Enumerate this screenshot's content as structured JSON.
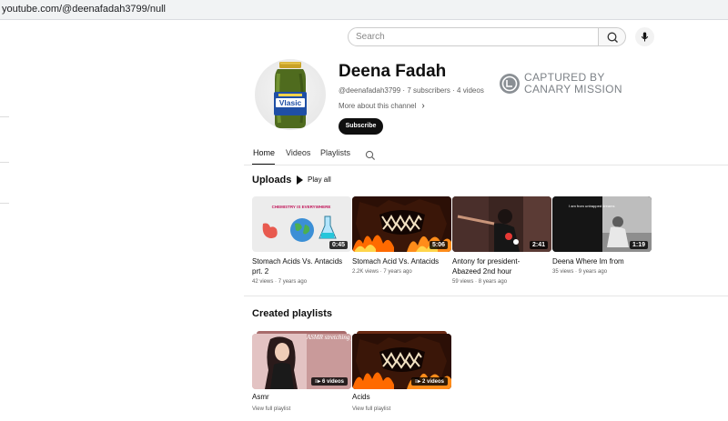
{
  "browser": {
    "url": "youtube.com/@deenafadah3799/null"
  },
  "search": {
    "placeholder": "Search"
  },
  "channel": {
    "name": "Deena Fadah",
    "handle": "@deenafadah3799",
    "subscribers": "7 subscribers",
    "videos_count": "4 videos",
    "more_about": "More about this channel",
    "subscribe_label": "Subscribe",
    "avatar_label": "Vlasic"
  },
  "watermark": {
    "line1": "CAPTURED BY",
    "line2": "CANARY MISSION"
  },
  "tabs": [
    {
      "label": "Home"
    },
    {
      "label": "Videos"
    },
    {
      "label": "Playlists"
    }
  ],
  "uploads": {
    "title": "Uploads",
    "play_all": "Play all",
    "videos": [
      {
        "title": "Stomach Acids Vs. Antacids prt. 2",
        "views": "42 views",
        "age": "7 years ago",
        "duration": "0:45",
        "thumb_text": "CHEMISTRY IS EVERYWHERE"
      },
      {
        "title": "Stomach Acid Vs. Antacids",
        "views": "2.2K views",
        "age": "7 years ago",
        "duration": "5:06"
      },
      {
        "title": "Antony for president- Abazeed 2nd hour",
        "views": "59 views",
        "age": "8 years ago",
        "duration": "2:41"
      },
      {
        "title": "Deena Where Im from",
        "views": "35 views",
        "age": "9 years ago",
        "duration": "1:19",
        "thumb_text": "I am from untrapped dreams"
      }
    ]
  },
  "playlists": {
    "title": "Created playlists",
    "items": [
      {
        "title": "Asmr",
        "count": "6 videos",
        "link": "View full playlist",
        "thumb_text": "ASMR stretching your brain"
      },
      {
        "title": "Acids",
        "count": "2 videos",
        "link": "View full playlist"
      }
    ]
  }
}
